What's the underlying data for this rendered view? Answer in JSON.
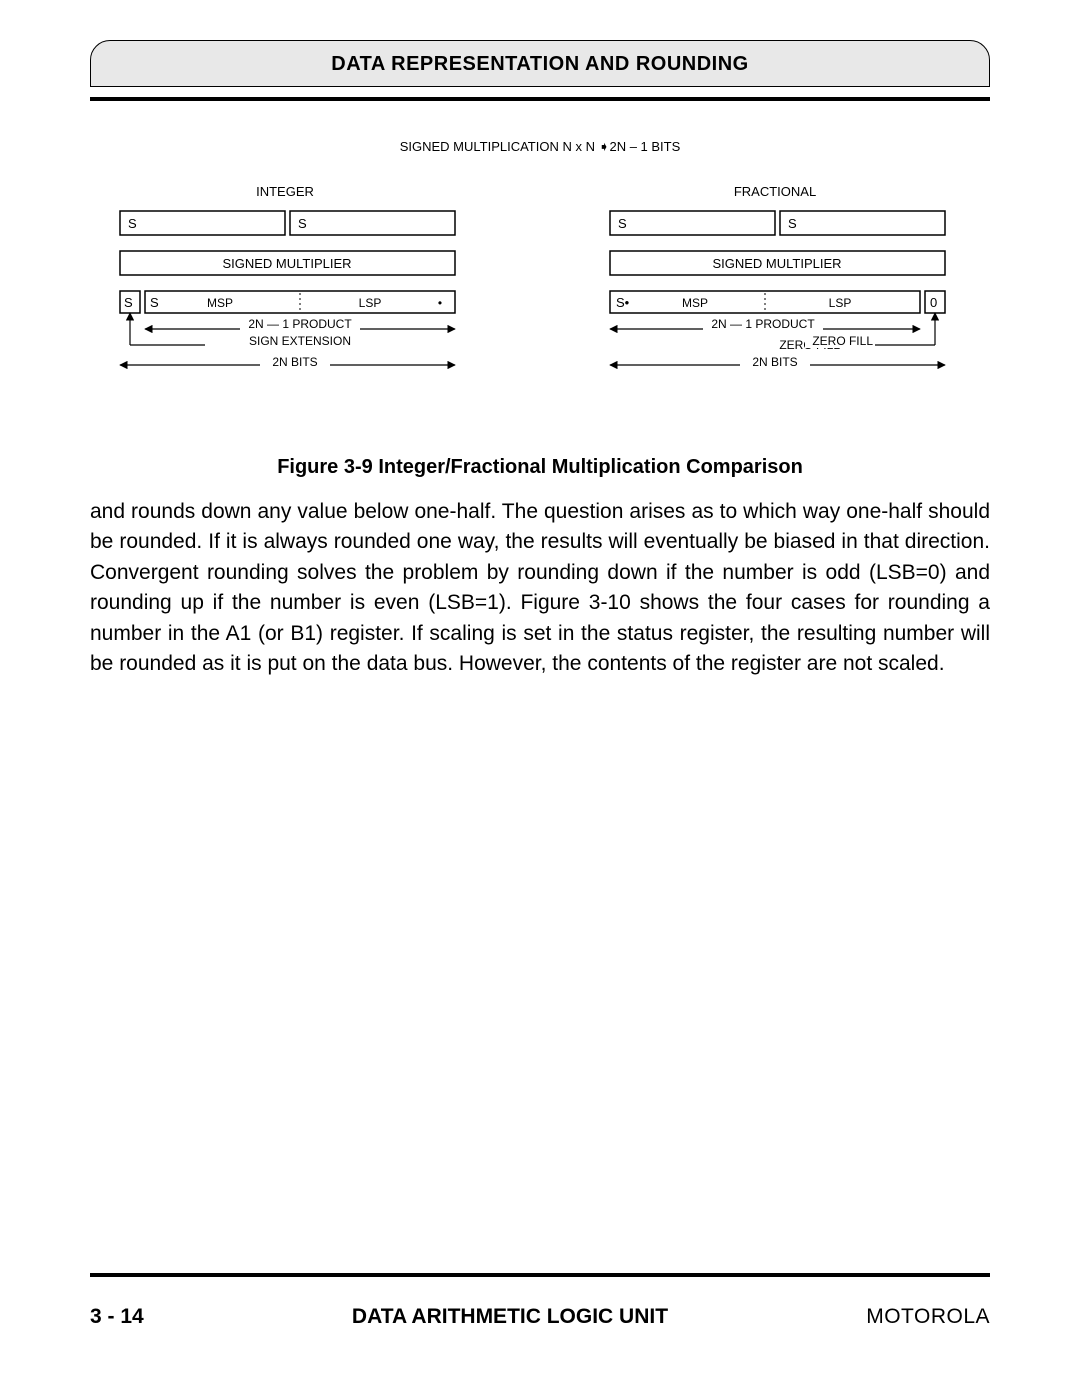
{
  "header": {
    "title": "DATA REPRESENTATION AND ROUNDING"
  },
  "diagram": {
    "top_label": "SIGNED MULTIPLICATION N x N ➧2N – 1 BITS",
    "left": {
      "heading": "INTEGER",
      "row1_a": "S",
      "row1_b": "S",
      "row2": "SIGNED MULTIPLIER",
      "row3_a": "S",
      "row3_b": "S",
      "row3_msp": "MSP",
      "row3_lsp": "LSP",
      "row3_dot1": "•",
      "row3_dot2": "•",
      "ann1": "2N — 1 PRODUCT",
      "ann2": "SIGN EXTENSION",
      "ann3": "2N BITS"
    },
    "right": {
      "heading": "FRACTIONAL",
      "row1_a": "S",
      "row1_b": "S",
      "row2": "SIGNED MULTIPLIER",
      "row3_a": "S•",
      "row3_msp": "MSP",
      "row3_lsp": "LSP",
      "row3_end": "0",
      "ann1": "2N — 1 PRODUCT",
      "ann2": "ZERO FILL",
      "ann3": "2N BITS"
    }
  },
  "caption": "Figure 3-9 Integer/Fractional Multiplication Comparison",
  "body": "and rounds down any value below one-half. The question arises as to which way one-half should be rounded. If it is always rounded one way, the results will eventually be biased in that direction. Convergent rounding solves the problem by rounding down if the number is odd (LSB=0) and rounding up if the number is even (LSB=1). Figure 3-10 shows the four cases for rounding a number in the A1 (or B1) register. If scaling is set in the status register, the resulting number will be rounded as it is put on the data bus. However, the contents of the register are not scaled.",
  "footer": {
    "page_num": "3 - 14",
    "title": "DATA ARITHMETIC LOGIC UNIT",
    "brand": "MOTOROLA"
  }
}
